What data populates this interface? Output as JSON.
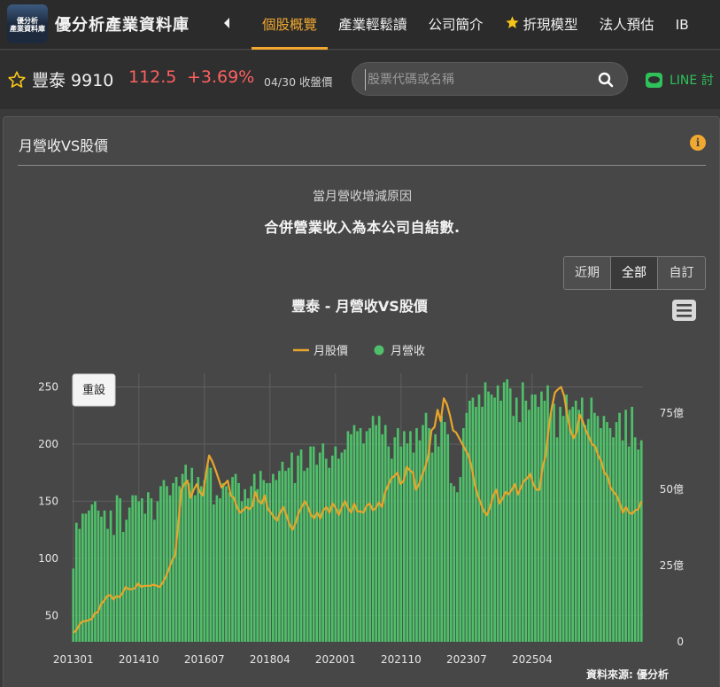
{
  "nav": {
    "brand": "優分析產業資料庫",
    "logo_text": "優分析\n產業資料庫",
    "tabs": [
      {
        "label": "個股概覽",
        "active": true
      },
      {
        "label": "產業輕鬆讀",
        "active": false
      },
      {
        "label": "公司簡介",
        "active": false
      },
      {
        "label": "折現模型",
        "active": false,
        "icon": "star-icon"
      },
      {
        "label": "法人預估",
        "active": false
      },
      {
        "label": "IB",
        "active": false
      }
    ]
  },
  "stock": {
    "name": "豐泰 9910",
    "price": "112.5",
    "change": "+3.69%",
    "date_label": "04/30 收盤價",
    "price_color": "#ff6060"
  },
  "search": {
    "placeholder": "股票代碼或名稱",
    "value": ""
  },
  "line_button": {
    "label": "LINE 討"
  },
  "panel": {
    "title": "月營收VS股價",
    "reason_title": "當月營收增減原因",
    "reason_text": "合併營業收入為本公司自結數.",
    "range_buttons": [
      {
        "label": "近期",
        "active": false
      },
      {
        "label": "全部",
        "active": true
      },
      {
        "label": "自訂",
        "active": false
      }
    ],
    "reset_label": "重設",
    "source_label": "資料來源: 優分析"
  },
  "colors": {
    "accent": "#f0a830",
    "price_line": "#e8a52b",
    "revenue_bar": "#4fc06a",
    "up": "#ff6060"
  },
  "chart_data": {
    "type": "bar+line",
    "title": "豐泰 - 月營收VS股價",
    "legend": [
      {
        "name": "月股價",
        "kind": "line"
      },
      {
        "name": "月營收",
        "kind": "bar"
      }
    ],
    "legend_position": "top-center",
    "grid": true,
    "x_tick_labels": [
      "201301",
      "201410",
      "201607",
      "201804",
      "202001",
      "202110",
      "202307",
      "202504"
    ],
    "x_range": [
      "2013-01",
      "2025-04"
    ],
    "left_axis": {
      "ticks": [
        50,
        100,
        150,
        200,
        250
      ],
      "ylim": [
        27,
        262
      ],
      "label": ""
    },
    "right_axis": {
      "ticks": [
        "0",
        "25億",
        "50億",
        "75億"
      ],
      "ylim": [
        0,
        88
      ],
      "unit": "億",
      "label": ""
    },
    "series": [
      {
        "name": "月營收",
        "type": "bar",
        "axis": "right",
        "unit": "億",
        "values": [
          24,
          39,
          37,
          42,
          42,
          43,
          45,
          46,
          43,
          41,
          43,
          37,
          43,
          35,
          48,
          47,
          36,
          40,
          44,
          48,
          48,
          46,
          47,
          42,
          49,
          47,
          40,
          46,
          51,
          53,
          51,
          48,
          52,
          54,
          51,
          55,
          58,
          52,
          57,
          48,
          54,
          51,
          53,
          58,
          57,
          45,
          48,
          47,
          52,
          51,
          49,
          54,
          55,
          52,
          46,
          50,
          47,
          51,
          55,
          50,
          56,
          53,
          52,
          52,
          55,
          53,
          56,
          59,
          56,
          57,
          62,
          52,
          61,
          63,
          56,
          57,
          64,
          64,
          58,
          62,
          65,
          60,
          57,
          61,
          64,
          60,
          62,
          63,
          69,
          68,
          71,
          69,
          70,
          65,
          69,
          70,
          74,
          71,
          74,
          68,
          71,
          64,
          60,
          67,
          70,
          64,
          69,
          65,
          69,
          62,
          70,
          66,
          71,
          75,
          70,
          62,
          68,
          64,
          74,
          72,
          68,
          52,
          51,
          49,
          54,
          70,
          75,
          79,
          80,
          77,
          81,
          77,
          85,
          82,
          81,
          80,
          84,
          79,
          85,
          86,
          83,
          74,
          80,
          72,
          85,
          79,
          76,
          81,
          81,
          77,
          82,
          79,
          84,
          75,
          78,
          67,
          77,
          74,
          81,
          76,
          77,
          79,
          76,
          80,
          71,
          73,
          80,
          75,
          74,
          70,
          74,
          72,
          70,
          67,
          72,
          75,
          66,
          76,
          64,
          77,
          67,
          63,
          66
        ]
      },
      {
        "name": "月股價",
        "type": "line",
        "axis": "left",
        "values": [
          35,
          37,
          42,
          45,
          45,
          46,
          47,
          52,
          53,
          60,
          63,
          67,
          68,
          64,
          67,
          66,
          70,
          75,
          73,
          73,
          74,
          78,
          75,
          76,
          76,
          76,
          77,
          76,
          75,
          79,
          84,
          91,
          98,
          103,
          130,
          160,
          165,
          168,
          153,
          160,
          165,
          158,
          155,
          175,
          190,
          185,
          178,
          170,
          162,
          165,
          168,
          155,
          153,
          145,
          140,
          142,
          145,
          143,
          146,
          158,
          150,
          148,
          155,
          143,
          140,
          136,
          133,
          140,
          145,
          138,
          130,
          125,
          131,
          140,
          145,
          150,
          145,
          138,
          135,
          140,
          135,
          142,
          145,
          140,
          148,
          144,
          138,
          145,
          150,
          144,
          140,
          148,
          141,
          141,
          140,
          146,
          148,
          142,
          144,
          149,
          145,
          158,
          164,
          170,
          172,
          175,
          165,
          168,
          180,
          177,
          175,
          160,
          165,
          173,
          180,
          190,
          212,
          215,
          230,
          220,
          240,
          235,
          225,
          212,
          210,
          205,
          200,
          195,
          190,
          180,
          165,
          155,
          148,
          141,
          138,
          145,
          155,
          160,
          148,
          152,
          158,
          156,
          160,
          165,
          156,
          162,
          168,
          170,
          174,
          165,
          160,
          160,
          180,
          190,
          215,
          232,
          245,
          248,
          250,
          242,
          225,
          212,
          205,
          210,
          226,
          220,
          212,
          206,
          200,
          198,
          190,
          185,
          175,
          172,
          162,
          158,
          155,
          148,
          140,
          145,
          140,
          139,
          142,
          143,
          150
        ]
      }
    ]
  }
}
